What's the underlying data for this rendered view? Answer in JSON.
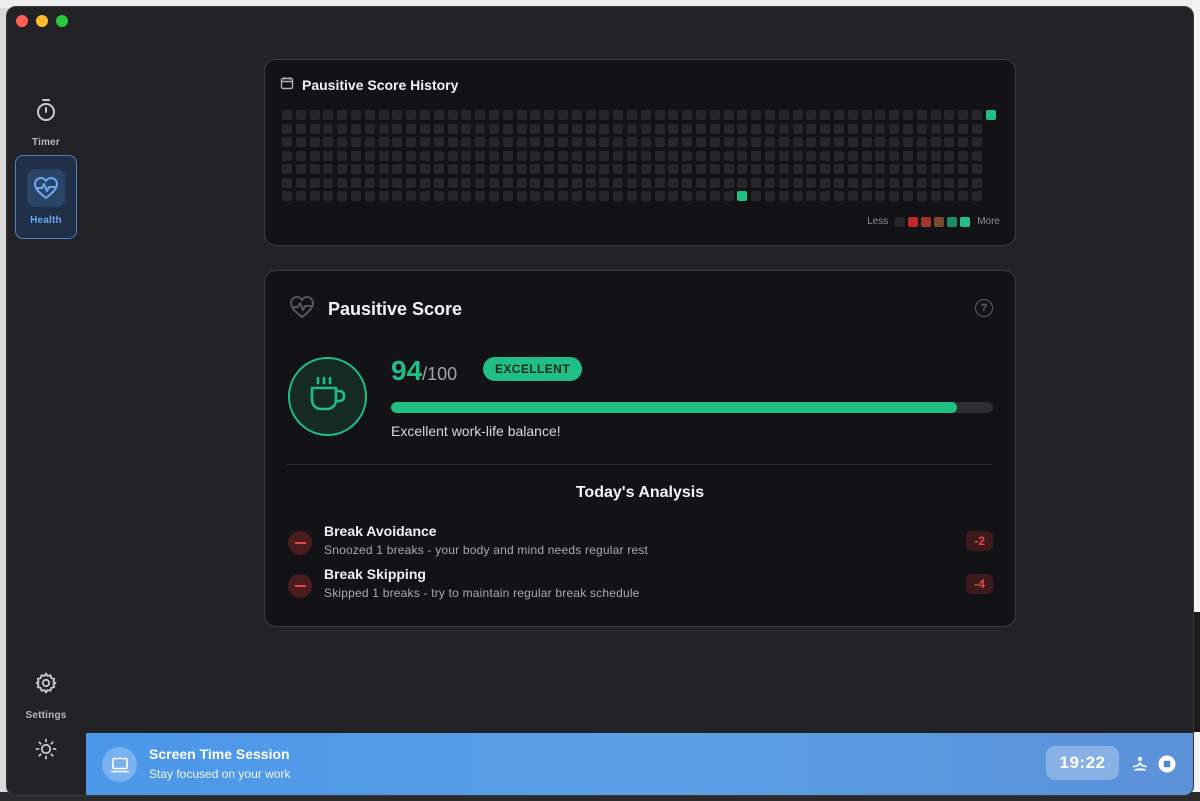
{
  "sidebar": {
    "items": [
      {
        "label": "Timer",
        "icon": "stopwatch-icon"
      },
      {
        "label": "Health",
        "icon": "heart-pulse-icon",
        "active": true
      },
      {
        "label": "Settings",
        "icon": "gear-icon"
      }
    ],
    "theme_icon": "sun-icon"
  },
  "history": {
    "title": "Pausitive Score History",
    "icon": "calendar-icon",
    "legend": {
      "less": "Less",
      "more": "More",
      "colors": [
        "#26262b",
        "#c0282c",
        "#a8352c",
        "#7a4a30",
        "#1a8f66",
        "#1fbf86"
      ]
    },
    "highlighted_days": [
      {
        "col": 33,
        "row": 6
      },
      {
        "col": 51,
        "row": 0
      }
    ]
  },
  "score": {
    "title": "Pausitive Score",
    "value": "94",
    "max": "/100",
    "progress": 0.94,
    "badge": "EXCELLENT",
    "message": "Excellent work-life balance!",
    "accent": "#1fbf86"
  },
  "analysis": {
    "title": "Today's Analysis",
    "items": [
      {
        "name": "Break Avoidance",
        "desc": "Snoozed 1 breaks - your body and mind needs regular rest",
        "points": "-2"
      },
      {
        "name": "Break Skipping",
        "desc": "Skipped 1 breaks - try to maintain regular break schedule",
        "points": "-4"
      }
    ]
  },
  "session": {
    "title": "Screen Time Session",
    "subtitle": "Stay focused on your work",
    "time": "19:22",
    "icon": "laptop-icon"
  }
}
